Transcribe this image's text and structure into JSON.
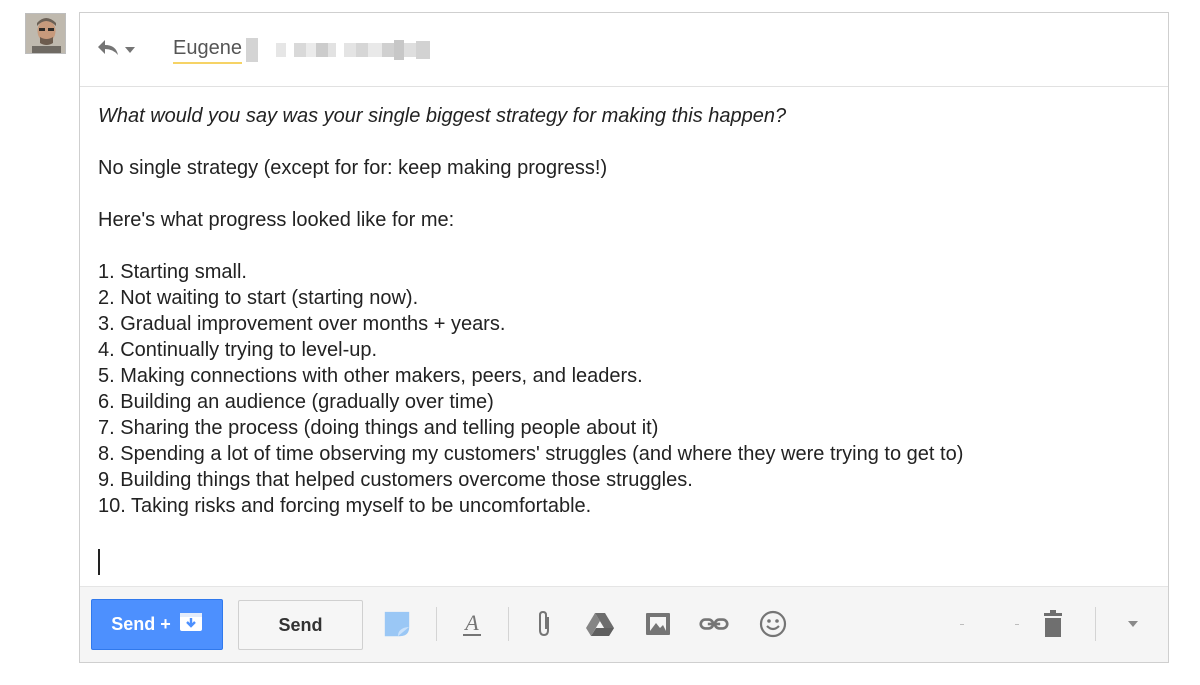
{
  "header": {
    "recipient_name": "Eugene",
    "reply_icon": "reply-icon",
    "dropdown_icon": "chevron-down-icon"
  },
  "message": {
    "question": "What would you say was your single biggest strategy for making this happen?",
    "answer": "No single strategy (except for for: keep making progress!)",
    "intro": "Here's what progress looked like for me:",
    "list": [
      "1. Starting small.",
      "2. Not waiting to start (starting now).",
      "3. Gradual improvement over months + years.",
      "4. Continually trying to level-up.",
      "5. Making connections with other makers, peers, and leaders.",
      "6. Building an audience (gradually over time)",
      "7. Sharing the process (doing things and telling people about it)",
      "8. Spending a lot of time observing my customers' struggles (and where they were trying to get to)",
      "9. Building things that helped customers overcome those struggles.",
      "10. Taking risks and forcing myself to be uncomfortable."
    ]
  },
  "toolbar": {
    "send_archive_label": "Send +",
    "send_label": "Send",
    "icons": [
      "app-icon",
      "formatting-icon",
      "attach-icon",
      "drive-icon",
      "photo-icon",
      "link-icon",
      "emoji-icon",
      "trash-icon",
      "more-options-icon"
    ]
  },
  "colors": {
    "primary_button": "#4d90fe",
    "recipient_underline": "#f6d365",
    "icon": "#757575"
  }
}
